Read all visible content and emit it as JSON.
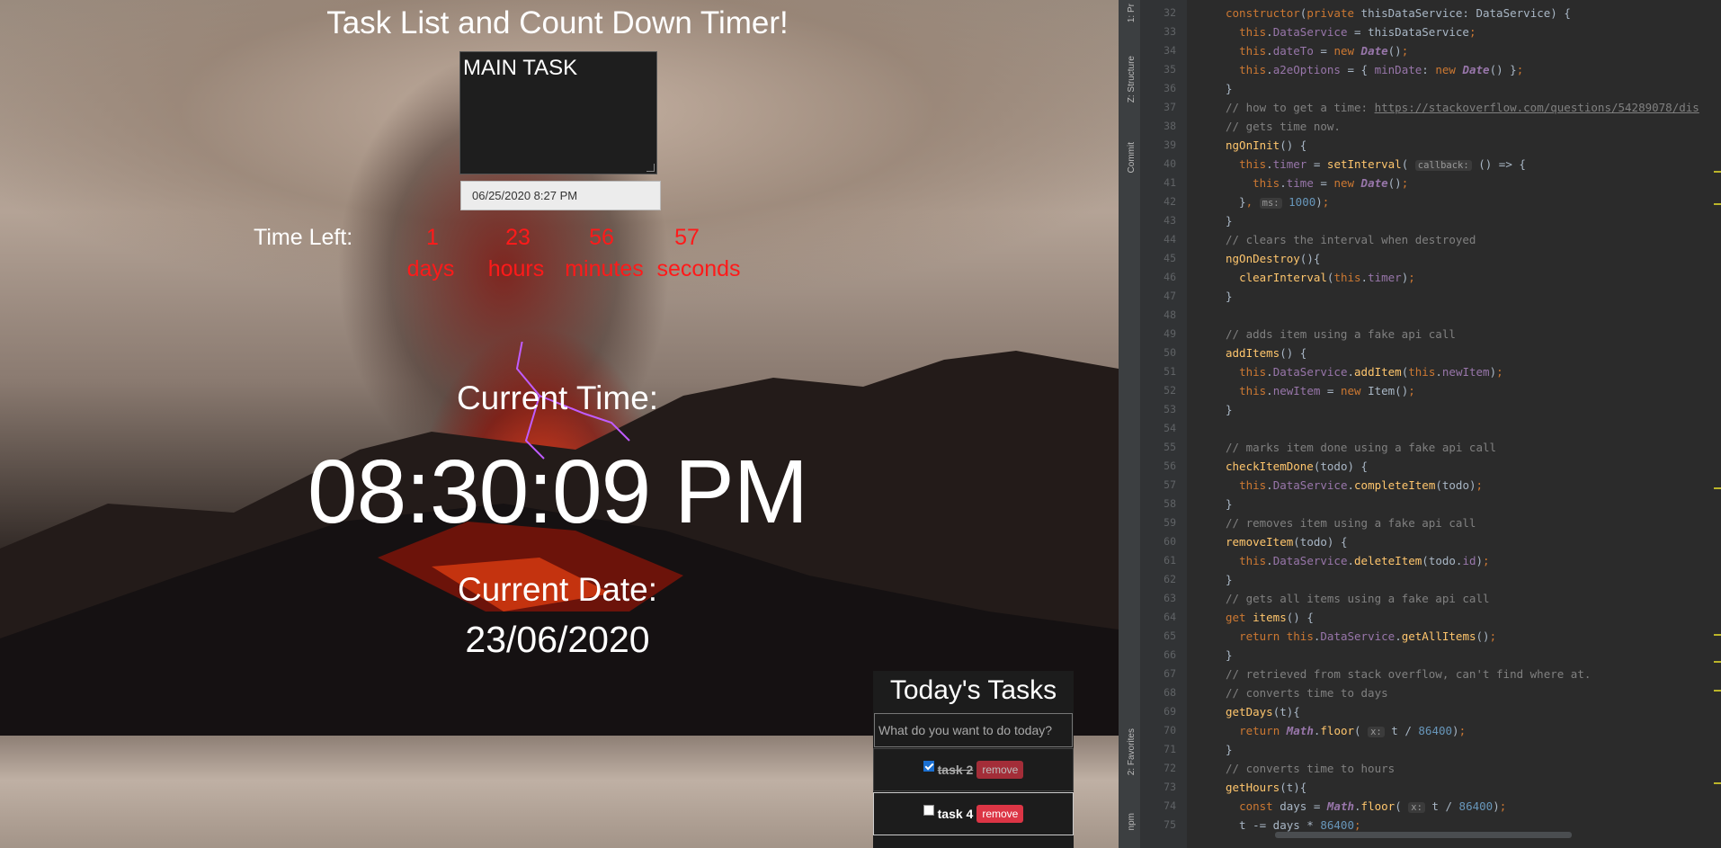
{
  "app": {
    "title": "Task List and Count Down Timer!",
    "main_task_text": "MAIN TASK",
    "date_value": "06/25/2020 8:27 PM",
    "time_left_label": "Time Left:",
    "countdown": [
      {
        "value": "1",
        "unit": "days"
      },
      {
        "value": "23",
        "unit": "hours"
      },
      {
        "value": "56",
        "unit": "minutes"
      },
      {
        "value": "57",
        "unit": "seconds"
      }
    ],
    "current_time_label": "Current Time:",
    "current_time": "08:30:09 PM",
    "current_date_label": "Current Date:",
    "current_date": "23/06/2020",
    "tasks": {
      "title": "Today's Tasks",
      "placeholder": "What do you want to do today?",
      "items": [
        {
          "text": "task 2",
          "done": true,
          "remove_label": "remove"
        },
        {
          "text": "task 4",
          "done": false,
          "remove_label": "remove"
        }
      ]
    },
    "colors": {
      "countdown": "#ff1a1a",
      "remove_button": "#dc3545"
    }
  },
  "ide": {
    "tool_tabs": [
      "1: Pr",
      "Z: Structure",
      "Commit",
      "2: Favorites",
      "npm"
    ],
    "lines": [
      {
        "n": "32",
        "html": "<span class='kw'>constructor</span><span class='plain'>(</span><span class='kw'>private </span><span class='plain'>thisDataService: DataService) {</span>"
      },
      {
        "n": "33",
        "html": "<span class='plain'>  </span><span class='kw'>this</span><span class='plain'>.</span><span class='fld'>DataService</span><span class='plain'> = thisDataService</span><span class='kw'>;</span>"
      },
      {
        "n": "34",
        "html": "<span class='plain'>  </span><span class='kw'>this</span><span class='plain'>.</span><span class='fld'>dateTo</span><span class='plain'> = </span><span class='kw'>new </span><span class='it'>Date</span><span class='plain'>()</span><span class='kw'>;</span>"
      },
      {
        "n": "35",
        "html": "<span class='plain'>  </span><span class='kw'>this</span><span class='plain'>.</span><span class='fld'>a2eOptions</span><span class='plain'> = { </span><span class='fld'>minDate</span><span class='plain'>: </span><span class='kw'>new </span><span class='it'>Date</span><span class='plain'>() }</span><span class='kw'>;</span>"
      },
      {
        "n": "36",
        "html": "<span class='plain'>}</span>"
      },
      {
        "n": "37",
        "html": "<span class='cm'>// how to get a time: </span><span class='lnk'>https://stackoverflow.com/questions/54289078/dis</span>"
      },
      {
        "n": "38",
        "html": "<span class='cm'>// gets time now.</span>"
      },
      {
        "n": "39",
        "html": "<span class='fn'>ngOnInit</span><span class='plain'>() {</span>"
      },
      {
        "n": "40",
        "html": "<span class='plain'>  </span><span class='kw'>this</span><span class='plain'>.</span><span class='fld'>timer</span><span class='plain'> = </span><span class='fn'>setInterval</span><span class='plain'>( </span><span class='hint'>callback:</span><span class='plain'> () => {</span>"
      },
      {
        "n": "41",
        "html": "<span class='plain'>    </span><span class='kw'>this</span><span class='plain'>.</span><span class='fld'>time</span><span class='plain'> = </span><span class='kw'>new </span><span class='it'>Date</span><span class='plain'>()</span><span class='kw'>;</span>"
      },
      {
        "n": "42",
        "html": "<span class='plain'>  }</span><span class='kw'>, </span><span class='hint'>ms:</span><span class='plain'> </span><span class='num'>1000</span><span class='plain'>)</span><span class='kw'>;</span>"
      },
      {
        "n": "43",
        "html": "<span class='plain'>}</span>"
      },
      {
        "n": "44",
        "html": "<span class='cm'>// clears the interval when destroyed</span>"
      },
      {
        "n": "45",
        "html": "<span class='fn'>ngOnDestroy</span><span class='plain'>(){</span>"
      },
      {
        "n": "46",
        "html": "<span class='plain'>  </span><span class='fn'>clearInterval</span><span class='plain'>(</span><span class='kw'>this</span><span class='plain'>.</span><span class='fld'>timer</span><span class='plain'>)</span><span class='kw'>;</span>"
      },
      {
        "n": "47",
        "html": "<span class='plain'>}</span>"
      },
      {
        "n": "48",
        "html": ""
      },
      {
        "n": "49",
        "html": "<span class='cm'>// adds item using a fake api call</span>"
      },
      {
        "n": "50",
        "html": "<span class='fn'>addItems</span><span class='plain'>() {</span>"
      },
      {
        "n": "51",
        "html": "<span class='plain'>  </span><span class='kw'>this</span><span class='plain'>.</span><span class='fld'>DataService</span><span class='plain'>.</span><span class='fn'>addItem</span><span class='plain'>(</span><span class='kw'>this</span><span class='plain'>.</span><span class='fld'>newItem</span><span class='plain'>)</span><span class='kw'>;</span>"
      },
      {
        "n": "52",
        "html": "<span class='plain'>  </span><span class='kw'>this</span><span class='plain'>.</span><span class='fld'>newItem</span><span class='plain'> = </span><span class='kw'>new </span><span class='plain'>Item()</span><span class='kw'>;</span>"
      },
      {
        "n": "53",
        "html": "<span class='plain'>}</span>"
      },
      {
        "n": "54",
        "html": ""
      },
      {
        "n": "55",
        "html": "<span class='cm'>// marks item done using a fake api call</span>"
      },
      {
        "n": "56",
        "html": "<span class='fn'>checkItemDone</span><span class='plain'>(todo) {</span>"
      },
      {
        "n": "57",
        "html": "<span class='plain'>  </span><span class='kw'>this</span><span class='plain'>.</span><span class='fld'>DataService</span><span class='plain'>.</span><span class='fn'>completeItem</span><span class='plain'>(todo)</span><span class='kw'>;</span>"
      },
      {
        "n": "58",
        "html": "<span class='plain'>}</span>"
      },
      {
        "n": "59",
        "html": "<span class='cm'>// removes item using a fake api call</span>"
      },
      {
        "n": "60",
        "html": "<span class='fn'>removeItem</span><span class='plain'>(todo) {</span>"
      },
      {
        "n": "61",
        "html": "<span class='plain'>  </span><span class='kw'>this</span><span class='plain'>.</span><span class='fld'>DataService</span><span class='plain'>.</span><span class='fn'>deleteItem</span><span class='plain'>(todo.</span><span class='fld'>id</span><span class='plain'>)</span><span class='kw'>;</span>"
      },
      {
        "n": "62",
        "html": "<span class='plain'>}</span>"
      },
      {
        "n": "63",
        "html": "<span class='cm'>// gets all items using a fake api call</span>"
      },
      {
        "n": "64",
        "html": "<span class='kw'>get </span><span class='fn'>items</span><span class='plain'>() {</span>"
      },
      {
        "n": "65",
        "html": "<span class='plain'>  </span><span class='kw'>return this</span><span class='plain'>.</span><span class='fld'>DataService</span><span class='plain'>.</span><span class='fn'>getAllItems</span><span class='plain'>()</span><span class='kw'>;</span>"
      },
      {
        "n": "66",
        "html": "<span class='plain'>}</span>"
      },
      {
        "n": "67",
        "html": "<span class='cm'>// retrieved from stack overflow, can't find where at.</span>"
      },
      {
        "n": "68",
        "html": "<span class='cm'>// converts time to days</span>"
      },
      {
        "n": "69",
        "html": "<span class='fn'>getDays</span><span class='plain'>(t){</span>"
      },
      {
        "n": "70",
        "html": "<span class='plain'>  </span><span class='kw'>return </span><span class='it'>Math</span><span class='plain'>.</span><span class='fn'>floor</span><span class='plain'>( </span><span class='hint'>x:</span><span class='plain'> t / </span><span class='num'>86400</span><span class='plain'>)</span><span class='kw'>;</span>"
      },
      {
        "n": "71",
        "html": "<span class='plain'>}</span>"
      },
      {
        "n": "72",
        "html": "<span class='cm'>// converts time to hours</span>"
      },
      {
        "n": "73",
        "html": "<span class='fn'>getHours</span><span class='plain'>(t){</span>"
      },
      {
        "n": "74",
        "html": "<span class='plain'>  </span><span class='kw'>const </span><span class='plain'>days = </span><span class='it'>Math</span><span class='plain'>.</span><span class='fn'>floor</span><span class='plain'>( </span><span class='hint'>x:</span><span class='plain'> t / </span><span class='num'>86400</span><span class='plain'>)</span><span class='kw'>;</span>"
      },
      {
        "n": "75",
        "html": "<span class='plain'>  t -= days * </span><span class='num'>86400</span><span class='kw'>;</span>"
      }
    ]
  }
}
